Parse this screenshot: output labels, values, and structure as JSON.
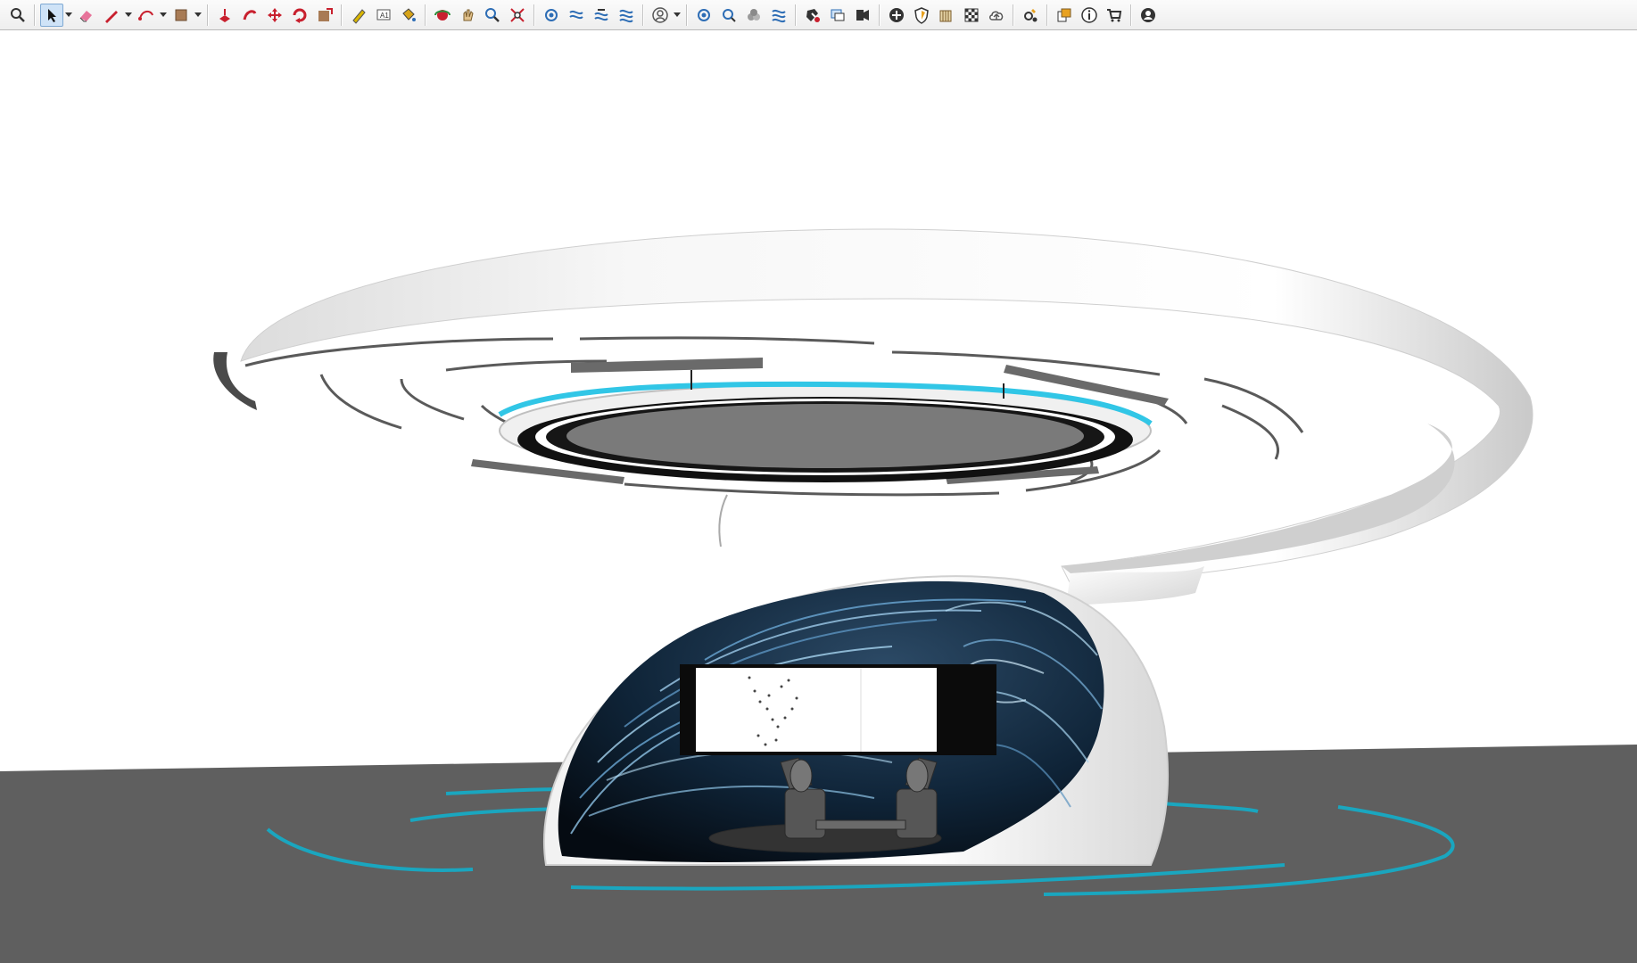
{
  "app": {
    "title": "",
    "viewport_label": ""
  },
  "toolbar": {
    "groups": [
      [
        "zoom-icon"
      ],
      [
        "select-icon",
        "eraser-icon",
        "pencil-line-icon",
        "arc-icon",
        "shape-icon"
      ],
      [
        "push-pull-icon",
        "follow-me-icon",
        "move-icon",
        "rotate-icon",
        "scale-icon"
      ],
      [
        "tape-measure-icon",
        "text-icon",
        "paint-bucket-icon"
      ],
      [
        "orbit-icon",
        "pan-icon",
        "zoom-window-icon",
        "zoom-extents-icon"
      ],
      [
        "sandbox-icon-1",
        "sandbox-icon-2",
        "sandbox-icon-3",
        "sandbox-icon-4"
      ],
      [
        "person-icon"
      ],
      [
        "sandbox-icon-5",
        "sandbox-icon-6",
        "sandbox-icon-7",
        "sandbox-icon-8"
      ],
      [
        "solid-tools-icon",
        "section-icon",
        "camera-icon"
      ],
      [
        "add-location-icon",
        "shield-icon",
        "warehouse-icon",
        "checker-icon",
        "cloud-icon"
      ],
      [
        "extension-manager-icon"
      ],
      [
        "layout-icon",
        "info-icon",
        "cart-icon"
      ],
      [
        "account-icon"
      ]
    ],
    "active": "select-icon",
    "colors": {
      "accent_active": "#cfe3f7",
      "icon_blue": "#2d6db5",
      "icon_red": "#c8202e"
    }
  },
  "scene": {
    "description_colors": {
      "ground": "#5f5f5f",
      "canopy": "#f4f4f4",
      "shadow": "#8a8a8a",
      "glow": "#31c6e6",
      "ring": "#1aa6bf",
      "screen": "#ffffff",
      "dome_inner": "#0d2033"
    }
  }
}
